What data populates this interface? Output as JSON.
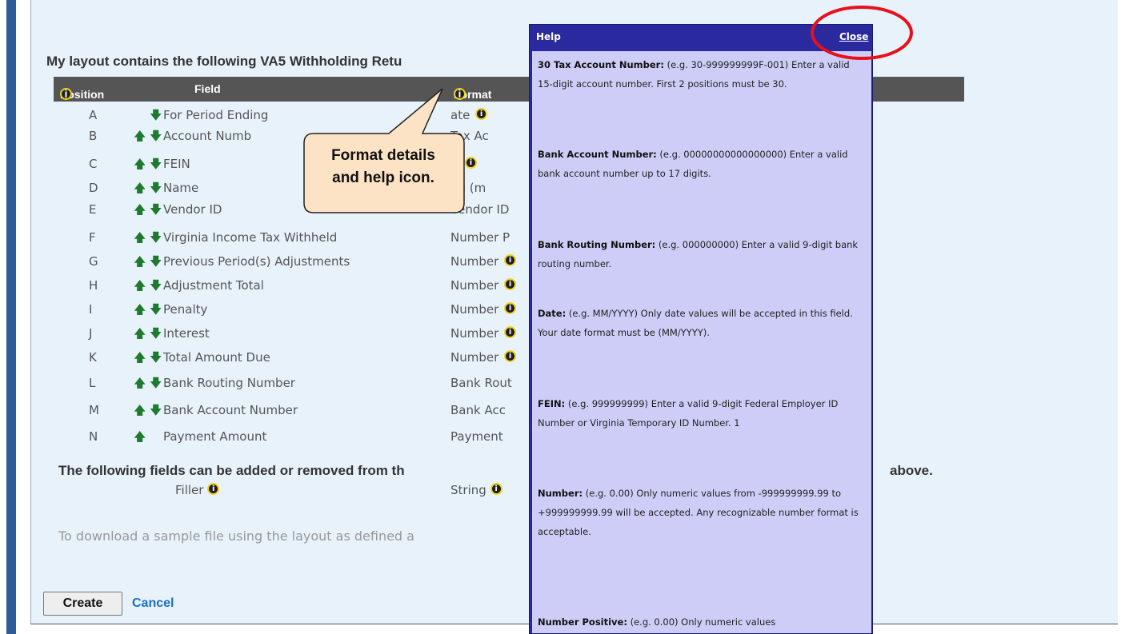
{
  "layout_title": "My layout contains the following VA5 Withholding Retu",
  "columns": {
    "position": "Position",
    "field": "Field",
    "format": "Format"
  },
  "rows": [
    {
      "pos": "A",
      "field": "For Period Ending",
      "format": "ate",
      "up": false,
      "down": true,
      "fmt_icon": true
    },
    {
      "pos": "B",
      "field": "Account Numb",
      "format": "Tax Ac",
      "up": true,
      "down": true,
      "fmt_icon": false
    },
    {
      "pos": "C",
      "field": "FEIN",
      "format": "N",
      "up": true,
      "down": true,
      "fmt_icon": true
    },
    {
      "pos": "D",
      "field": "Name",
      "format": "ng (m",
      "up": true,
      "down": true,
      "fmt_icon": false
    },
    {
      "pos": "E",
      "field": "Vendor ID",
      "format": "Vendor ID",
      "up": true,
      "down": true,
      "fmt_icon": false
    },
    {
      "pos": "F",
      "field": "Virginia Income Tax Withheld",
      "format": "Number P",
      "up": true,
      "down": true,
      "fmt_icon": false
    },
    {
      "pos": "G",
      "field": "Previous Period(s) Adjustments",
      "format": "Number",
      "up": true,
      "down": true,
      "fmt_icon": true
    },
    {
      "pos": "H",
      "field": "Adjustment Total",
      "format": "Number",
      "up": true,
      "down": true,
      "fmt_icon": true
    },
    {
      "pos": "I",
      "field": "Penalty",
      "format": "Number",
      "up": true,
      "down": true,
      "fmt_icon": true
    },
    {
      "pos": "J",
      "field": "Interest",
      "format": "Number",
      "up": true,
      "down": true,
      "fmt_icon": true
    },
    {
      "pos": "K",
      "field": "Total Amount Due",
      "format": "Number",
      "up": true,
      "down": true,
      "fmt_icon": true
    },
    {
      "pos": "L",
      "field": "Bank Routing Number",
      "format": "Bank Rout",
      "up": true,
      "down": true,
      "fmt_icon": false
    },
    {
      "pos": "M",
      "field": "Bank Account Number",
      "format": "Bank Acc",
      "up": true,
      "down": true,
      "fmt_icon": false
    },
    {
      "pos": "N",
      "field": "Payment Amount",
      "format": "Payment",
      "up": true,
      "down": false,
      "fmt_icon": false
    }
  ],
  "optional_heading": "The following fields can be added or removed from th",
  "optional_heading_tail": "above.",
  "optional_fields": [
    {
      "field": "Filler",
      "format": "String"
    }
  ],
  "download_text": "To download a sample file using the layout as defined a",
  "buttons": {
    "create": "Create",
    "cancel": "Cancel"
  },
  "callout": {
    "line1": "Format details",
    "line2": "and help icon."
  },
  "help": {
    "title": "Help",
    "close": "Close",
    "entries": [
      {
        "term": "30 Tax Account Number:",
        "text": " (e.g. 30-999999999F-001) Enter a valid 15-digit account number. First 2 positions must be 30."
      },
      {
        "term": "Bank Account Number:",
        "text": " (e.g. 00000000000000000) Enter a valid bank account number up to 17 digits."
      },
      {
        "term": "Bank Routing Number:",
        "text": " (e.g. 000000000) Enter a valid 9-digit bank routing number."
      },
      {
        "term": "Date:",
        "text": " (e.g. MM/YYYY) Only date values will be accepted in this field. Your date format must be (MM/YYYY)."
      },
      {
        "term": "FEIN:",
        "text": " (e.g. 999999999) Enter a valid 9-digit Federal Employer ID Number or Virginia Temporary ID Number. 1"
      },
      {
        "term": "Number:",
        "text": " (e.g. 0.00) Only numeric values from -999999999.99 to +999999999.99 will be accepted. Any recognizable number format is acceptable."
      },
      {
        "term": "Number Positive:",
        "text": " (e.g. 0.00) Only numeric values"
      }
    ]
  },
  "colors": {
    "header_bg": "#555555",
    "panel_bg": "#e8f2fb",
    "help_bg": "#2a2a9e",
    "help_body": "#cdcdf7",
    "annotation_red": "#e8101a",
    "callout_bg": "#fde3c6"
  }
}
